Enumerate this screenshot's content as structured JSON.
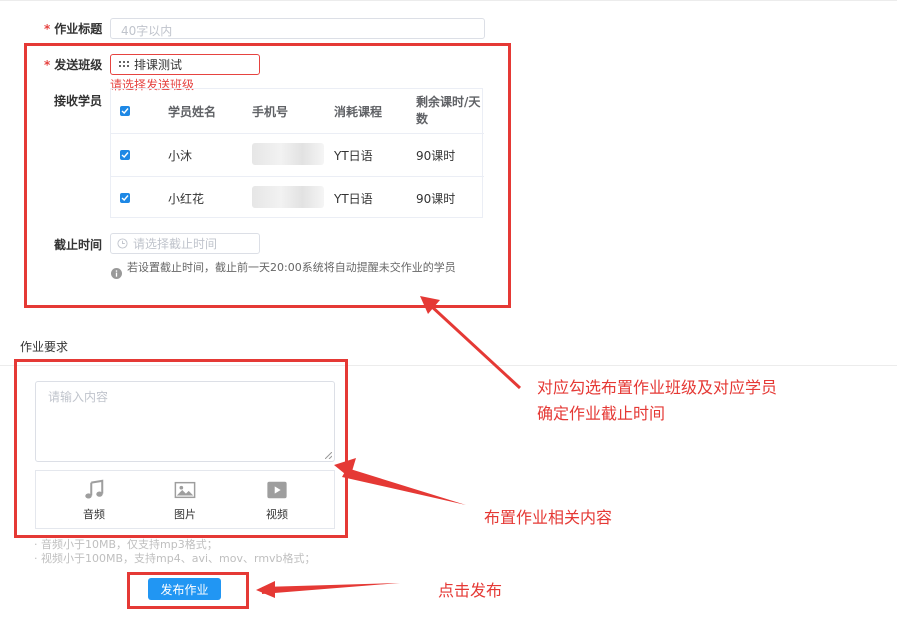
{
  "form": {
    "title_label": "作业标题",
    "title_placeholder": "40字以内",
    "class_label": "发送班级",
    "class_value": "排课测试",
    "class_error": "请选择发送班级",
    "students_label": "接收学员",
    "deadline_label": "截止时间",
    "deadline_placeholder": "请选择截止时间",
    "deadline_hint": "若设置截止时间，截止前一天20:00系统将自动提醒未交作业的学员",
    "requirements_label": "作业要求",
    "content_placeholder": "请输入内容",
    "submit_label": "发布作业"
  },
  "table": {
    "headers": [
      "学员姓名",
      "手机号",
      "消耗课程",
      "剩余课时/天数"
    ],
    "rows": [
      {
        "name": "小沐",
        "course": "YT日语",
        "remaining": "90课时"
      },
      {
        "name": "小红花",
        "course": "YT日语",
        "remaining": "90课时"
      }
    ]
  },
  "media": {
    "items": [
      {
        "label": "音频",
        "icon": "music-note-icon"
      },
      {
        "label": "图片",
        "icon": "image-icon"
      },
      {
        "label": "视频",
        "icon": "video-play-icon"
      }
    ],
    "limits": [
      "音频小于10MB，仅支持mp3格式；",
      "视频小于100MB，支持mp4、avi、mov、rmvb格式；"
    ]
  },
  "annotations": {
    "a1_line1": "对应勾选布置作业班级及对应学员",
    "a1_line2": "确定作业截止时间",
    "a2": "布置作业相关内容",
    "a3": "点击发布"
  },
  "colors": {
    "accent": "#2196f3",
    "annotation": "#e53935",
    "error": "#e64340"
  }
}
